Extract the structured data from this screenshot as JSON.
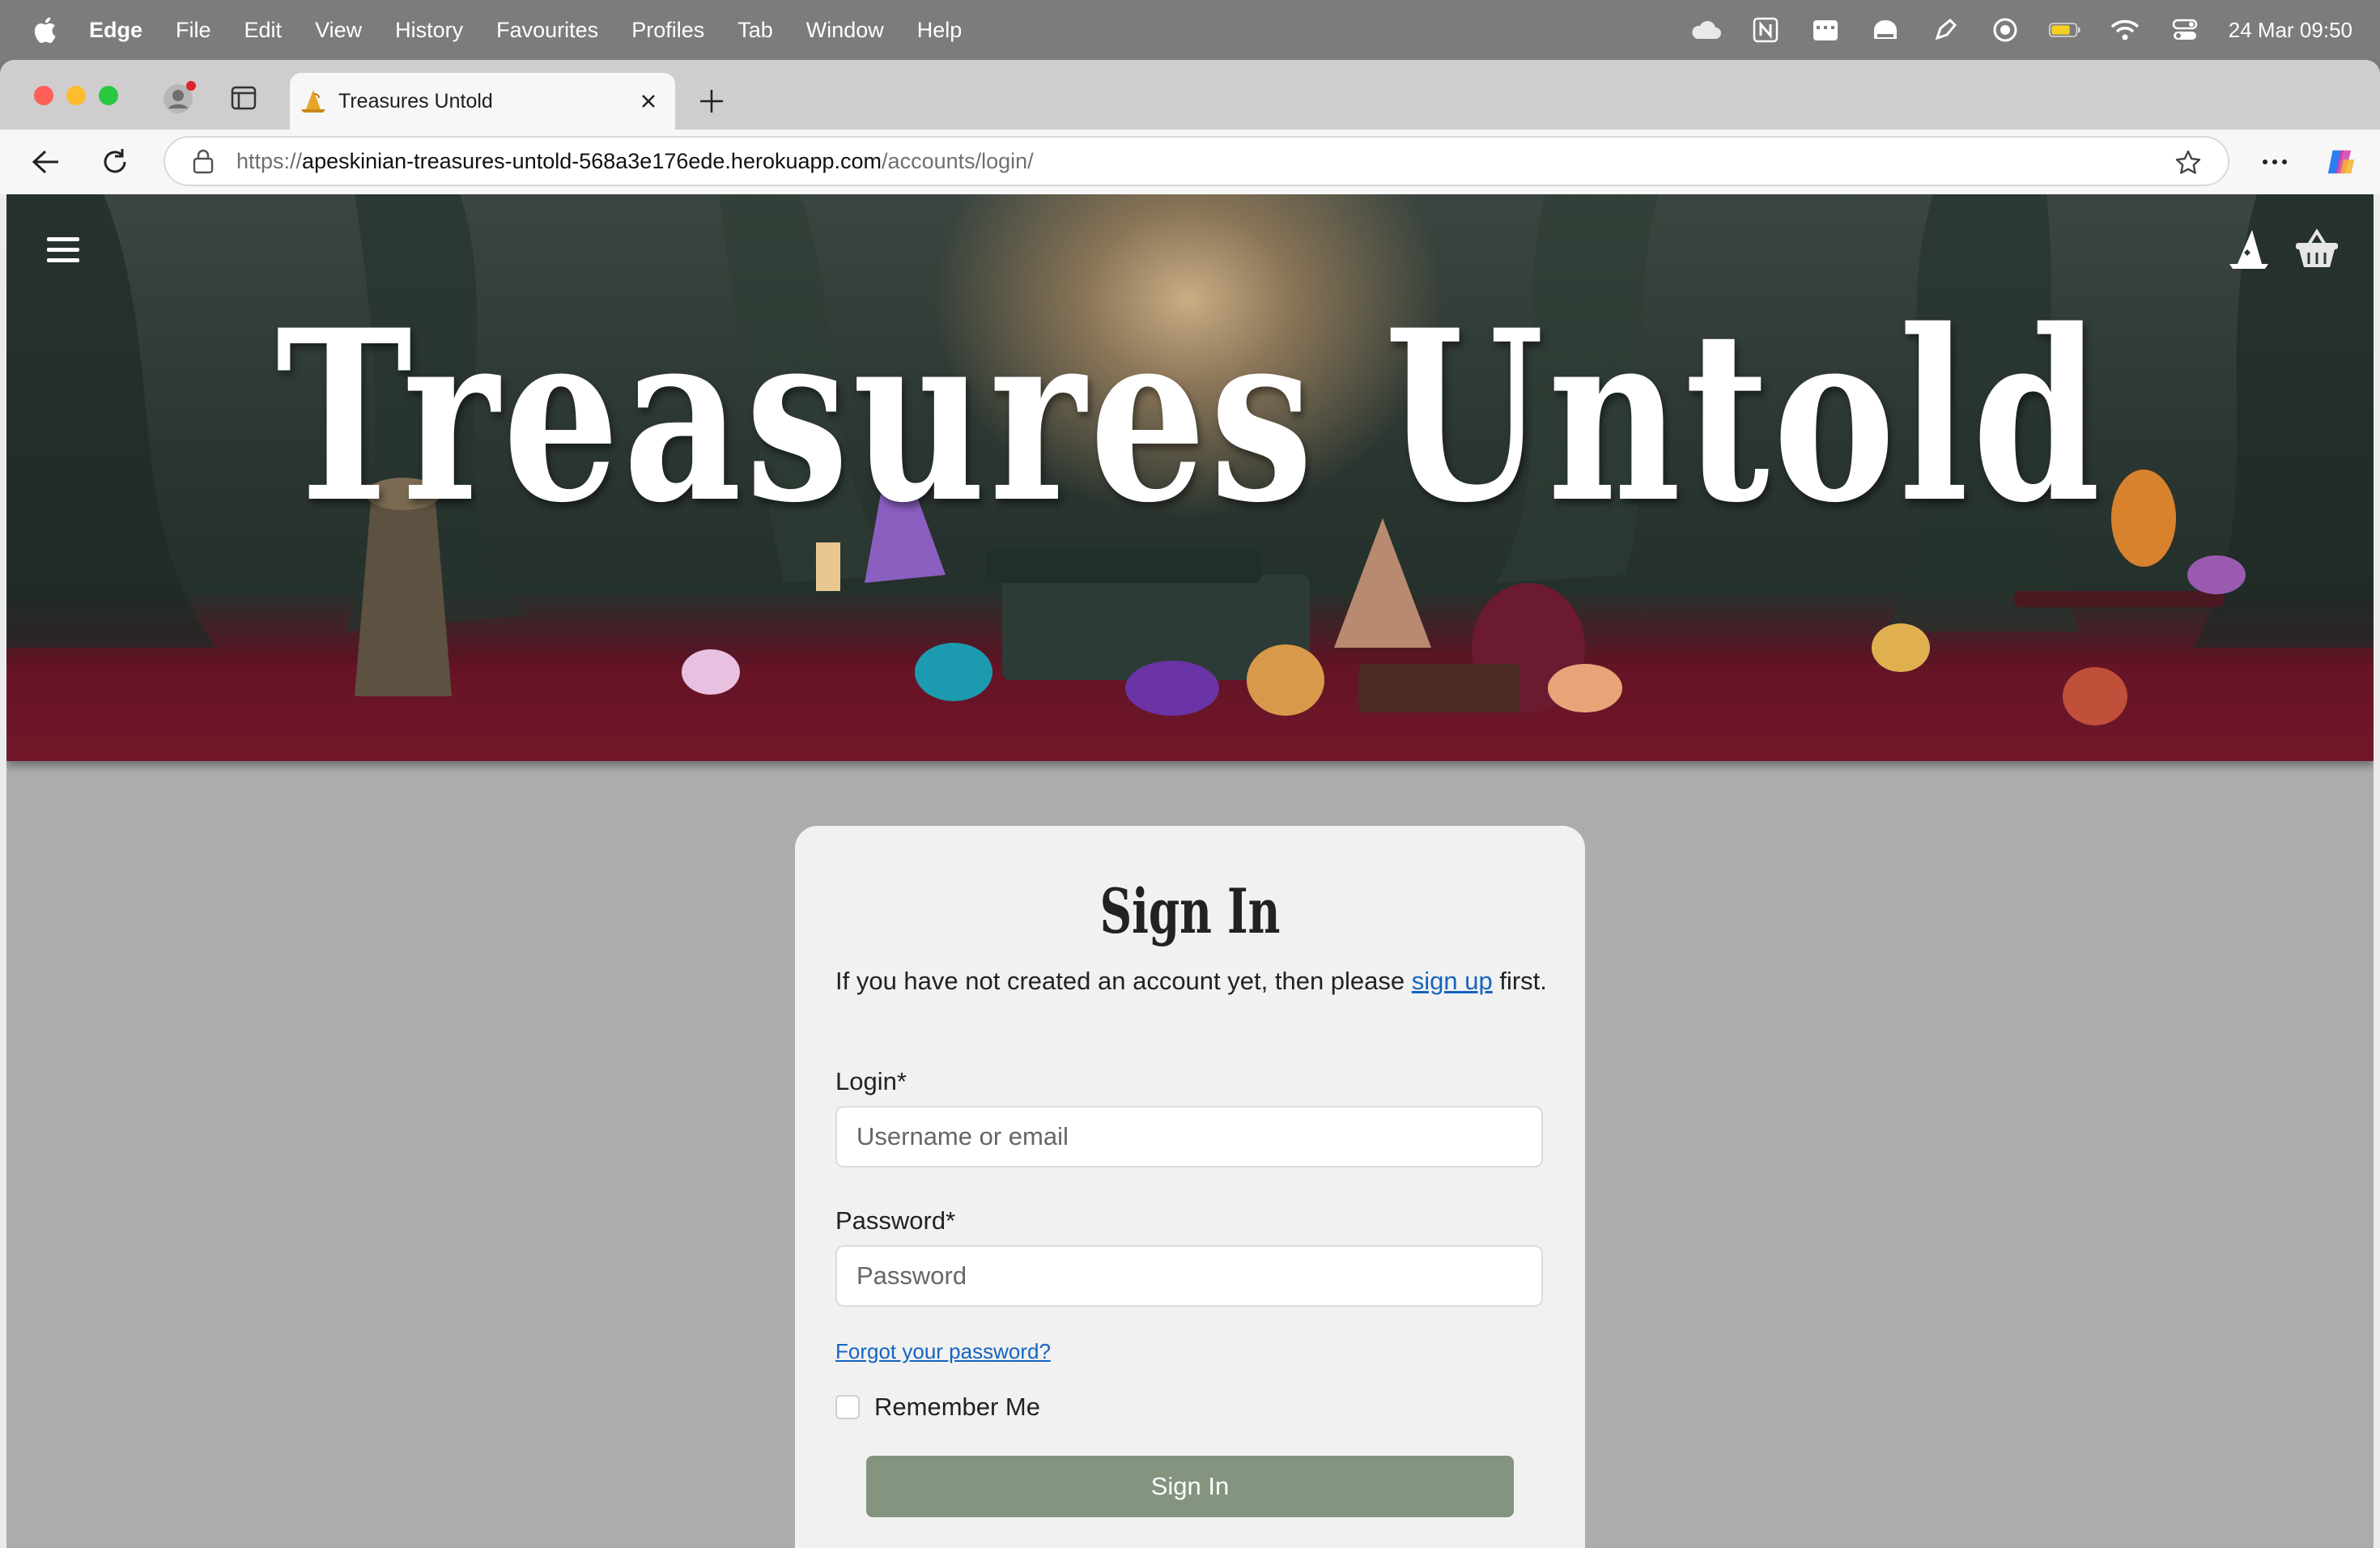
{
  "menubar": {
    "app_name": "Edge",
    "items": [
      "File",
      "Edit",
      "View",
      "History",
      "Favourites",
      "Profiles",
      "Tab",
      "Window",
      "Help"
    ],
    "clock": "24 Mar  09:50",
    "status_icons": [
      "cloud-icon",
      "notion-icon",
      "calendar-icon",
      "app-icon",
      "pen-icon",
      "focus-icon",
      "battery-icon",
      "wifi-icon",
      "control-center-icon"
    ]
  },
  "browser": {
    "tab_title": "Treasures Untold",
    "url_scheme": "https://",
    "url_host": "apeskinian-treasures-untold-568a3e176ede.herokuapp.com",
    "url_path": "/accounts/login/"
  },
  "site": {
    "title": "Treasures Untold"
  },
  "signin": {
    "heading": "Sign In",
    "intro_before": "If you have not created an account yet, then please ",
    "intro_link": "sign up",
    "intro_after": " first.",
    "login_label": "Login*",
    "login_placeholder": "Username or email",
    "password_label": "Password*",
    "password_placeholder": "Password",
    "forgot_link": "Forgot your password?",
    "remember_label": "Remember Me",
    "remember_checked": false,
    "submit_label": "Sign In"
  },
  "colors": {
    "button": "#84947e",
    "link": "#1565c0",
    "page_bg": "#acacac",
    "card_bg": "#f1f1f1"
  }
}
